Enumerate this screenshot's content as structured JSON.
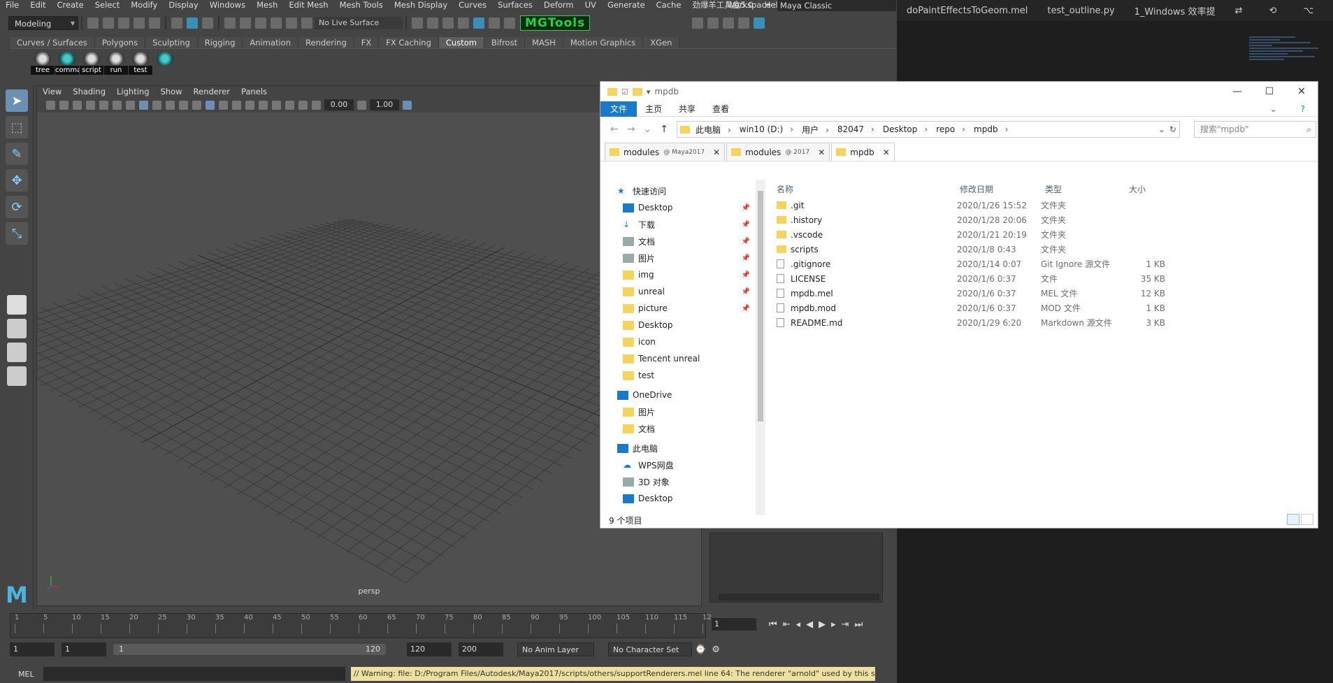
{
  "maya": {
    "menu": [
      "File",
      "Edit",
      "Create",
      "Select",
      "Modify",
      "Display",
      "Windows",
      "Mesh",
      "Edit Mesh",
      "Mesh Tools",
      "Mesh Display",
      "Curves",
      "Surfaces",
      "Deform",
      "UV",
      "Generate",
      "Cache",
      "劲爆羊工具盒5.0",
      "Help"
    ],
    "workspace_label": "Workspace :",
    "workspace_value": "Maya Classic",
    "mode": "Modeling",
    "live_surface": "No Live Surface",
    "mgtools": "MGTools",
    "shelf_tabs": [
      "Curves / Surfaces",
      "Polygons",
      "Sculpting",
      "Rigging",
      "Animation",
      "Rendering",
      "FX",
      "FX Caching",
      "Custom",
      "Bifrost",
      "MASH",
      "Motion Graphics",
      "XGen"
    ],
    "shelf_active": "Custom",
    "shelf_items": [
      "tree",
      "comma",
      "script",
      "run",
      "test",
      ""
    ],
    "viewport_menu": [
      "View",
      "Shading",
      "Lighting",
      "Show",
      "Renderer",
      "Panels"
    ],
    "viewport_fields": [
      "0.00",
      "1.00"
    ],
    "camera": "persp",
    "timeline_ticks": [
      "1",
      "5",
      "10",
      "15",
      "20",
      "25",
      "30",
      "35",
      "40",
      "45",
      "50",
      "55",
      "60",
      "65",
      "70",
      "75",
      "80",
      "85",
      "90",
      "95",
      "100",
      "105",
      "110",
      "115",
      "12"
    ],
    "current_frame": "1",
    "range": {
      "start": "1",
      "start2": "1",
      "slider_start": "1",
      "slider_end": "120",
      "end": "120",
      "end2": "200"
    },
    "anim_layer": "No Anim Layer",
    "char_set": "No Character Set",
    "mel_label": "MEL",
    "warning": "// Warning: file: D:/Program Files/Autodesk/Maya2017/scripts/others/supportRenderers.mel line 64: The renderer \"arnold\" used by this scene, is n"
  },
  "vscode": {
    "tabs": [
      "doPaintEffectsToGeom.mel",
      "test_outline.py",
      "1_Windows 效率提"
    ]
  },
  "explorer": {
    "title": "mpdb",
    "ribbon": [
      "文件",
      "主页",
      "共享",
      "查看"
    ],
    "breadcrumbs": [
      "此电脑",
      "win10 (D:)",
      "用户",
      "82047",
      "Desktop",
      "repo",
      "mpdb"
    ],
    "search_placeholder": "搜索\"mpdb\"",
    "tabs": [
      {
        "label": "modules",
        "sub": "@ Maya2017"
      },
      {
        "label": "modules",
        "sub": "@ 2017"
      },
      {
        "label": "mpdb",
        "sub": ""
      }
    ],
    "nav": [
      {
        "label": "快速访问",
        "type": "hdr"
      },
      {
        "label": "Desktop",
        "icon": "blue",
        "pin": true
      },
      {
        "label": "下载",
        "icon": "none",
        "pin": true
      },
      {
        "label": "文档",
        "icon": "gray",
        "pin": true
      },
      {
        "label": "图片",
        "icon": "gray",
        "pin": true
      },
      {
        "label": "img",
        "icon": "",
        "pin": true
      },
      {
        "label": "unreal",
        "icon": "",
        "pin": true
      },
      {
        "label": "picture",
        "icon": "",
        "pin": true
      },
      {
        "label": "Desktop",
        "icon": "",
        "pin": false
      },
      {
        "label": "icon",
        "icon": "",
        "pin": false
      },
      {
        "label": "Tencent unreal",
        "icon": "",
        "pin": false
      },
      {
        "label": "test",
        "icon": "",
        "pin": false
      },
      {
        "label": "OneDrive",
        "type": "hdr"
      },
      {
        "label": "图片",
        "icon": "",
        "pin": false
      },
      {
        "label": "文档",
        "icon": "",
        "pin": false
      },
      {
        "label": "此电脑",
        "type": "hdr"
      },
      {
        "label": "WPS网盘",
        "icon": "none",
        "pin": false
      },
      {
        "label": "3D 对象",
        "icon": "gray",
        "pin": false
      },
      {
        "label": "Desktop",
        "icon": "blue",
        "pin": false
      }
    ],
    "columns": [
      "名称",
      "修改日期",
      "类型",
      "大小"
    ],
    "files": [
      {
        "name": ".git",
        "date": "2020/1/26 15:52",
        "type": "文件夹",
        "size": "",
        "folder": true
      },
      {
        "name": ".history",
        "date": "2020/1/28 20:06",
        "type": "文件夹",
        "size": "",
        "folder": true
      },
      {
        "name": ".vscode",
        "date": "2020/1/21 20:19",
        "type": "文件夹",
        "size": "",
        "folder": true
      },
      {
        "name": "scripts",
        "date": "2020/1/8 0:43",
        "type": "文件夹",
        "size": "",
        "folder": true
      },
      {
        "name": ".gitignore",
        "date": "2020/1/14 0:07",
        "type": "Git Ignore 源文件",
        "size": "1 KB",
        "folder": false
      },
      {
        "name": "LICENSE",
        "date": "2020/1/6 0:37",
        "type": "文件",
        "size": "35 KB",
        "folder": false
      },
      {
        "name": "mpdb.mel",
        "date": "2020/1/6 0:37",
        "type": "MEL 文件",
        "size": "12 KB",
        "folder": false
      },
      {
        "name": "mpdb.mod",
        "date": "2020/1/6 0:37",
        "type": "MOD 文件",
        "size": "1 KB",
        "folder": false
      },
      {
        "name": "README.md",
        "date": "2020/1/29 6:20",
        "type": "Markdown 源文件",
        "size": "3 KB",
        "folder": false
      }
    ],
    "status": "9 个项目"
  }
}
